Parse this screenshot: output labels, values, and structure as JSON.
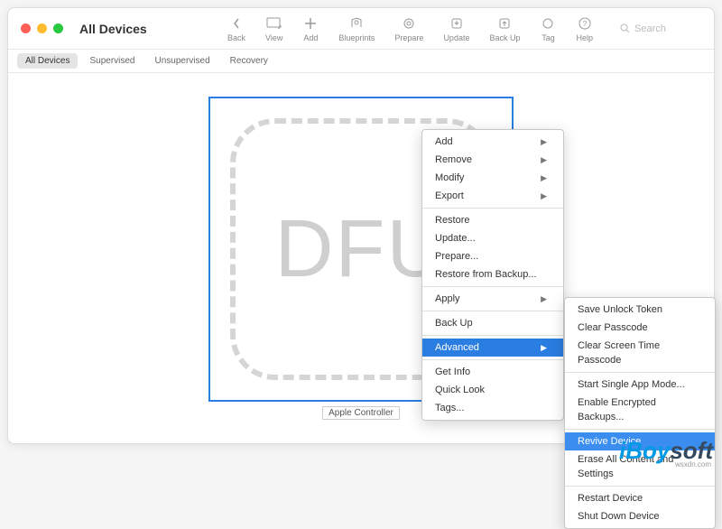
{
  "window": {
    "title": "All Devices"
  },
  "toolbar": {
    "back": "Back",
    "view": "View",
    "add": "Add",
    "blueprints": "Blueprints",
    "prepare": "Prepare",
    "update": "Update",
    "backup": "Back Up",
    "tag": "Tag",
    "help": "Help",
    "search_placeholder": "Search"
  },
  "tabs": {
    "all": "All Devices",
    "supervised": "Supervised",
    "unsupervised": "Unsupervised",
    "recovery": "Recovery"
  },
  "device": {
    "dfu_text": "DFU",
    "label": "Apple Controller"
  },
  "menu1": {
    "add": "Add",
    "remove": "Remove",
    "modify": "Modify",
    "export": "Export",
    "restore": "Restore",
    "update": "Update...",
    "prepare": "Prepare...",
    "restore_backup": "Restore from Backup...",
    "apply": "Apply",
    "backup": "Back Up",
    "advanced": "Advanced",
    "getinfo": "Get Info",
    "quicklook": "Quick Look",
    "tags": "Tags..."
  },
  "menu2": {
    "save_token": "Save Unlock Token",
    "clear_pass": "Clear Passcode",
    "clear_screen": "Clear Screen Time Passcode",
    "single_app": "Start Single App Mode...",
    "enc_backup": "Enable Encrypted Backups...",
    "revive": "Revive Device",
    "erase": "Erase All Content and Settings",
    "restart": "Restart Device",
    "shutdown": "Shut Down Device"
  },
  "watermark": {
    "brand_i": "iBoy",
    "brand_b": "soft",
    "sub": "wsxdn.com"
  }
}
